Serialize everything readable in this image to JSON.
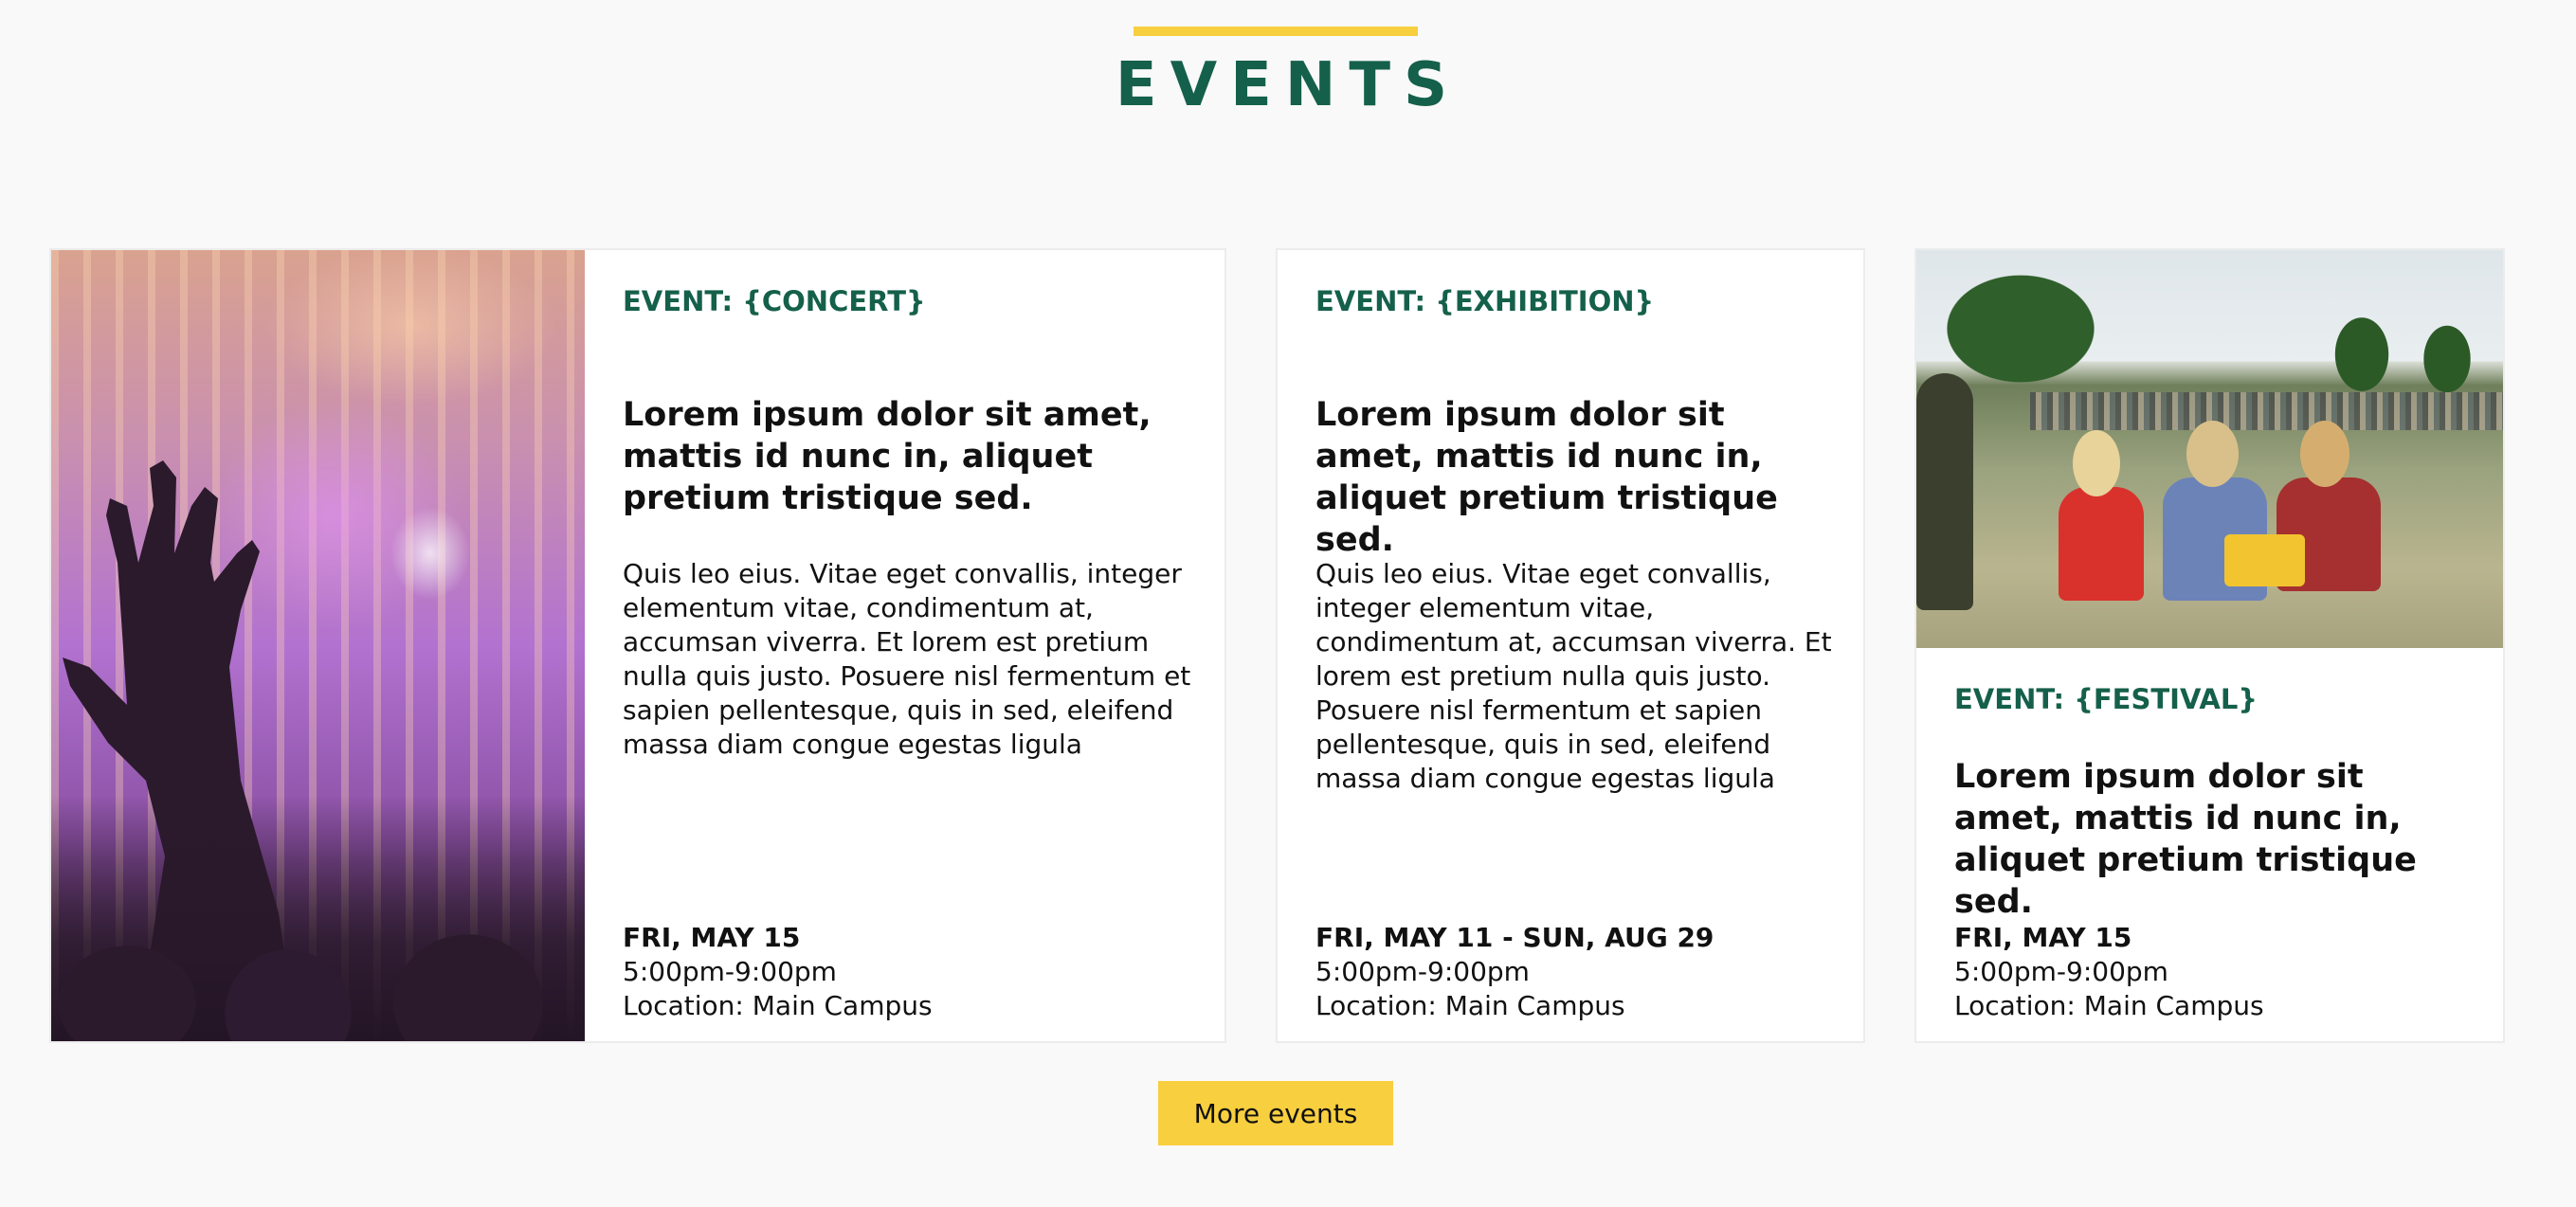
{
  "section": {
    "title": "EVENTS",
    "accent_color": "#f8cf3f",
    "title_color": "#15604a"
  },
  "events": [
    {
      "type_label": "EVENT: {CONCERT}",
      "headline": "Lorem ipsum dolor sit amet, mattis id nunc in, aliquet pretium tristique sed.",
      "description": "Quis leo eius. Vitae eget convallis, integer elementum vitae, condimentum at, accumsan viverra. Et lorem est pretium nulla quis justo. Posuere nisl fermentum et sapien pellentesque, quis in sed, eleifend massa diam congue egestas ligula",
      "date": "FRI, MAY 15",
      "time": "5:00pm-9:00pm",
      "location": "Location: Main Campus",
      "image": "concert-crowd-photo"
    },
    {
      "type_label": "EVENT: {EXHIBITION}",
      "headline": "Lorem ipsum dolor sit amet, mattis id nunc in, aliquet pretium tristique sed.",
      "description": "Quis leo eius. Vitae eget convallis, integer elementum vitae, condimentum at, accumsan viverra. Et lorem est pretium nulla quis justo. Posuere nisl fermentum et sapien pellentesque, quis in sed, eleifend massa diam congue egestas ligula",
      "date": "FRI, MAY 11 - SUN, AUG 29",
      "time": "5:00pm-9:00pm",
      "location": "Location: Main Campus"
    },
    {
      "type_label": "EVENT: {FESTIVAL}",
      "headline": "Lorem ipsum dolor sit amet, mattis id nunc in, aliquet pretium tristique sed.",
      "date": "FRI, MAY 15",
      "time": "5:00pm-9:00pm",
      "location": "Location: Main Campus",
      "image": "festival-lawn-photo"
    }
  ],
  "more_button_label": "More events"
}
